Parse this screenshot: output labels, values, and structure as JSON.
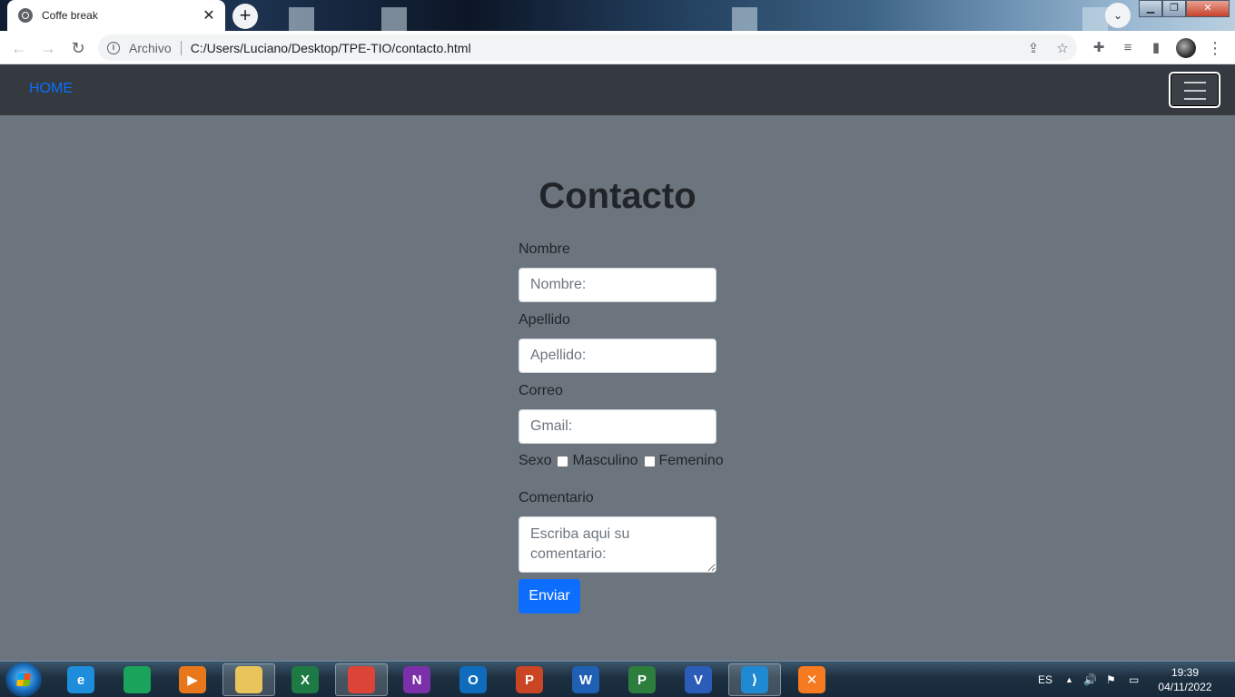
{
  "browser": {
    "tab_title": "Coffe break",
    "tab_close": "✕",
    "new_tab": "+",
    "tab_search": "⌄",
    "window_buttons": {
      "minimize": "▁",
      "restore": "❐",
      "close": "✕"
    },
    "nav": {
      "back": "←",
      "forward": "→",
      "reload": "↻"
    },
    "address": {
      "info": "i",
      "scheme_label": "Archivo",
      "url": "C:/Users/Luciano/Desktop/TPE-TIO/contacto.html",
      "share_icon": "⇪",
      "bookmark_icon": "☆"
    },
    "toolbar_icons": {
      "extensions": "✚",
      "media": "≡",
      "sidepanel": "▮",
      "menu": "⋮"
    }
  },
  "navbar": {
    "home_label": "HOME"
  },
  "form": {
    "title": "Contacto",
    "nombre": {
      "label": "Nombre",
      "placeholder": "Nombre:"
    },
    "apellido": {
      "label": "Apellido",
      "placeholder": "Apellido:"
    },
    "correo": {
      "label": "Correo",
      "placeholder": "Gmail:"
    },
    "sexo": {
      "label": "Sexo",
      "option1": "Masculino",
      "option2": "Femenino"
    },
    "comentario": {
      "label": "Comentario",
      "placeholder": "Escriba aqui su comentario:"
    },
    "submit_label": "Enviar"
  },
  "taskbar": {
    "apps": [
      {
        "name": "internet-explorer",
        "glyph": "e",
        "color": "#1e8ddc"
      },
      {
        "name": "edge",
        "glyph": "",
        "color": "#1aa35a"
      },
      {
        "name": "media-player",
        "glyph": "▶",
        "color": "#e8761a"
      },
      {
        "name": "file-explorer",
        "glyph": "",
        "color": "#e9c45a"
      },
      {
        "name": "excel",
        "glyph": "X",
        "color": "#1d7a45"
      },
      {
        "name": "chrome",
        "glyph": "",
        "color": "#db4437"
      },
      {
        "name": "onenote",
        "glyph": "N",
        "color": "#7b2fa8"
      },
      {
        "name": "outlook",
        "glyph": "O",
        "color": "#0f6cbd"
      },
      {
        "name": "powerpoint",
        "glyph": "P",
        "color": "#c94524"
      },
      {
        "name": "word",
        "glyph": "W",
        "color": "#1f5fb4"
      },
      {
        "name": "project",
        "glyph": "P",
        "color": "#2d7d3d"
      },
      {
        "name": "visio",
        "glyph": "V",
        "color": "#2b5db8"
      },
      {
        "name": "vscode",
        "glyph": "⟩",
        "color": "#1f8ad2"
      },
      {
        "name": "xampp",
        "glyph": "✕",
        "color": "#f57a20"
      }
    ],
    "language": "ES",
    "tray_arrow": "▲",
    "volume": "🔊",
    "flag": "⚑",
    "network": "▭",
    "time": "19:39",
    "date": "04/11/2022"
  }
}
